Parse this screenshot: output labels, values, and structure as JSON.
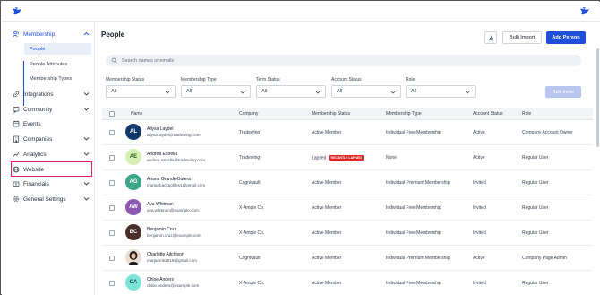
{
  "colors": {
    "accent": "#1e4fd8",
    "highlight": "#e0245e",
    "badge": "#dc2626"
  },
  "sidebar": {
    "items": [
      {
        "label": "Membership",
        "icon": "users-icon",
        "expanded": true
      },
      {
        "label": "Integrations",
        "icon": "link-icon"
      },
      {
        "label": "Community",
        "icon": "community-icon"
      },
      {
        "label": "Events",
        "icon": "calendar-icon"
      },
      {
        "label": "Companies",
        "icon": "building-icon"
      },
      {
        "label": "Analytics",
        "icon": "chart-icon"
      },
      {
        "label": "Website",
        "icon": "globe-icon"
      },
      {
        "label": "Financials",
        "icon": "wallet-icon"
      },
      {
        "label": "General Settings",
        "icon": "gear-icon"
      }
    ],
    "sub_items": [
      "People",
      "People Attributes",
      "Membership Types"
    ]
  },
  "header": {
    "title": "People",
    "bulk_import": "Bulk Import",
    "add_person": "Add Person"
  },
  "search": {
    "placeholder": "Search names or emails"
  },
  "filters": [
    {
      "label": "Membership Status",
      "value": "All"
    },
    {
      "label": "Membership Type",
      "value": "All"
    },
    {
      "label": "Term Status",
      "value": "All"
    },
    {
      "label": "Account Status",
      "value": "All"
    },
    {
      "label": "Role",
      "value": "All"
    }
  ],
  "bulk_invite": "Bulk Invite",
  "table": {
    "columns": [
      "Name",
      "Company",
      "Membership Status",
      "Membership Type",
      "Account Status",
      "Role"
    ],
    "rows": [
      {
        "initials": "AL",
        "name": "Allysa Laydel",
        "email": "allysa.laydel@tradewing.com",
        "company": "Tradewing",
        "membership_status": "Active Member",
        "badge": "",
        "membership_type": "Individual Free Membership",
        "account_status": "Active",
        "role": "Company Account Owner"
      },
      {
        "initials": "AE",
        "name": "Andrea Estrella",
        "email": "andrea.estrella@tradewing.com",
        "company": "Tradewing",
        "membership_status": "Lapsed",
        "badge": "RECENTLY LAPSED",
        "membership_type": "None",
        "account_status": "Active",
        "role": "Regular User"
      },
      {
        "initials": "AG",
        "name": "Ariana Grande-Butera",
        "email": "marianbackupfiles1@gmail.com",
        "company": "Cognivault",
        "membership_status": "Active Member",
        "badge": "",
        "membership_type": "Individual Premium Membership",
        "account_status": "Invited",
        "role": "Regular User"
      },
      {
        "initials": "AW",
        "name": "Ava Whitman",
        "email": "ava.whitman@example.com",
        "company": "X-Ample Co.",
        "membership_status": "Active Member",
        "badge": "",
        "membership_type": "Individual Free Membership",
        "account_status": "Invited",
        "role": "Regular User"
      },
      {
        "initials": "BC",
        "name": "Benjamin Cruz",
        "email": "benjamin.cruz@example.com",
        "company": "X-Ample Co.",
        "membership_status": "Active Member",
        "badge": "",
        "membership_type": "Individual Free Membership",
        "account_status": "Invited",
        "role": "Regular User"
      },
      {
        "initials": "",
        "name": "Charlotte Aitchison",
        "email": "marjanmk2019@gmail.com",
        "company": "Cognivault",
        "membership_status": "Active Member",
        "badge": "",
        "membership_type": "Individual Premium Membership",
        "account_status": "Active",
        "role": "Company Page Admin"
      },
      {
        "initials": "CA",
        "name": "Chloe Anders",
        "email": "chloe.anders@example.com",
        "company": "X-Ample Co.",
        "membership_status": "Active Member",
        "badge": "",
        "membership_type": "Individual Free Membership",
        "account_status": "Invited",
        "role": "Regular User"
      }
    ]
  }
}
